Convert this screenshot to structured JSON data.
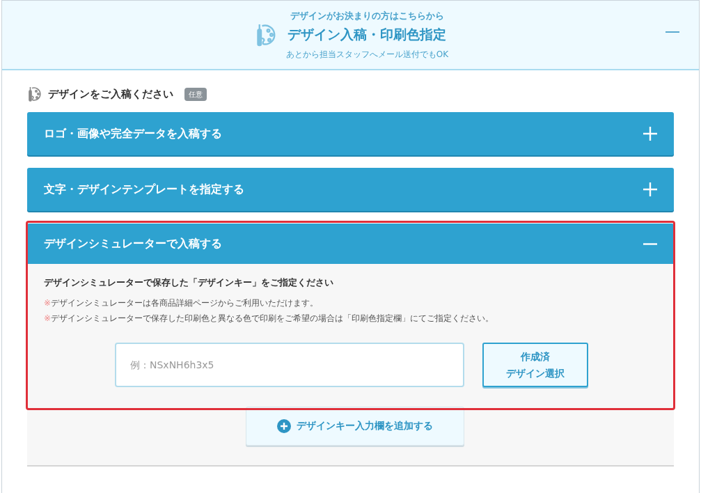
{
  "header": {
    "eyebrow": "デザインがお決まりの方はこちらから",
    "title": "デザイン入稿・印刷色指定",
    "note": "あとから担当スタッフへメール送付でもOK",
    "expanded": true
  },
  "section": {
    "title": "デザインをご入稿ください",
    "badge": "任意"
  },
  "accordions": [
    {
      "title": "ロゴ・画像や完全データを入稿する",
      "expanded": false,
      "highlighted": false
    },
    {
      "title": "文字・デザインテンプレートを指定する",
      "expanded": false,
      "highlighted": false
    },
    {
      "title": "デザインシミュレーターで入稿する",
      "expanded": true,
      "highlighted": true,
      "body": {
        "heading": "デザインシミュレーターで保存した「デザインキー」をご指定ください",
        "notes": [
          {
            "mark": "※",
            "text": "デザインシミュレーターは各商品詳細ページからご利用いただけます。"
          },
          {
            "mark": "※",
            "text": "デザインシミュレーターで保存した印刷色と異なる色で印刷をご希望の場合は「印刷色指定欄」にてご指定ください。"
          }
        ],
        "input": {
          "placeholder": "例：NSxNH6h3x5"
        },
        "select_button": [
          "作成済",
          "デザイン選択"
        ],
        "add_button": "デザインキー入力欄を追加する"
      }
    }
  ]
}
